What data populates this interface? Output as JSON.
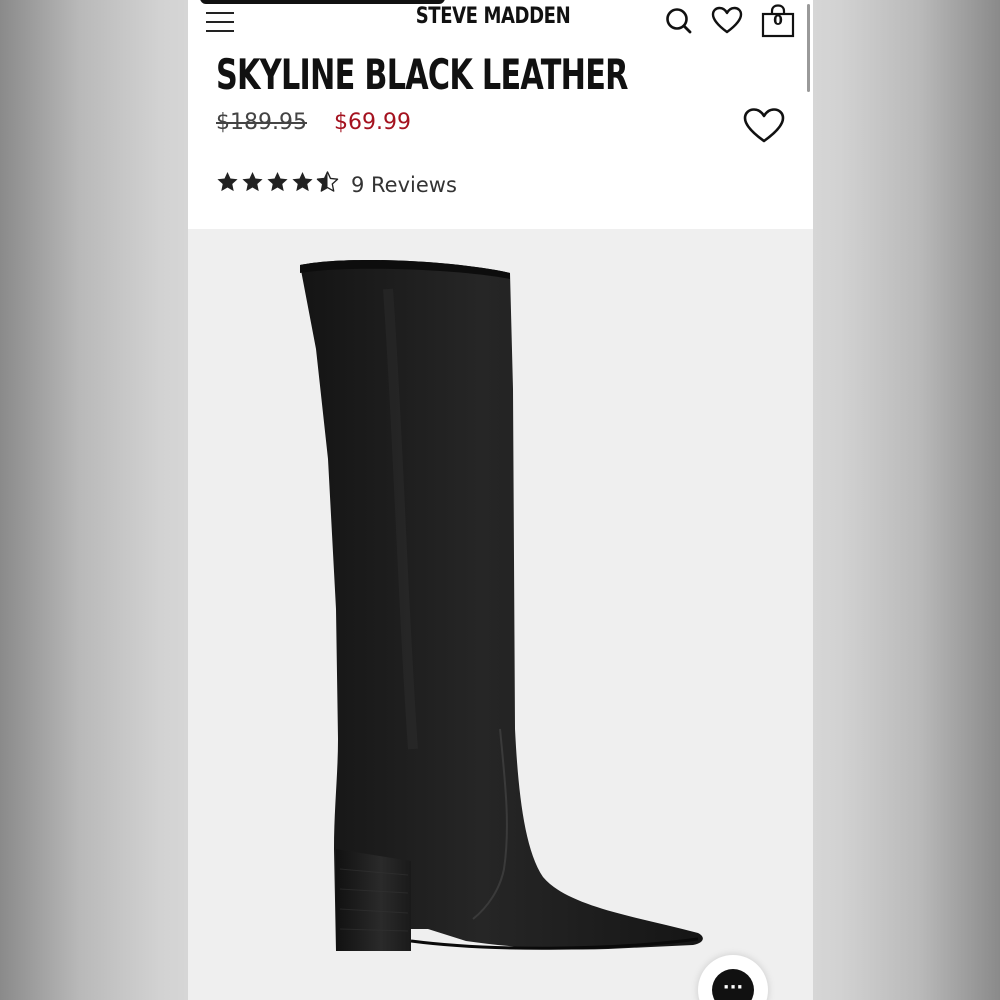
{
  "header": {
    "brand": "STEVE MADDEN",
    "icons": [
      "menu-icon",
      "search-icon",
      "heart-icon",
      "bag-icon"
    ],
    "cart_count": "0"
  },
  "product": {
    "title": "SKYLINE BLACK LEATHER",
    "original_price": "$189.95",
    "sale_price": "$69.99",
    "rating": 4.5,
    "rating_max": 5,
    "reviews_label": "9 Reviews"
  },
  "chat": {
    "label": "···"
  },
  "colors": {
    "sale_price": "#a4121f",
    "text": "#111111",
    "image_bg": "#efefef",
    "boot": "#1b1b1b"
  }
}
